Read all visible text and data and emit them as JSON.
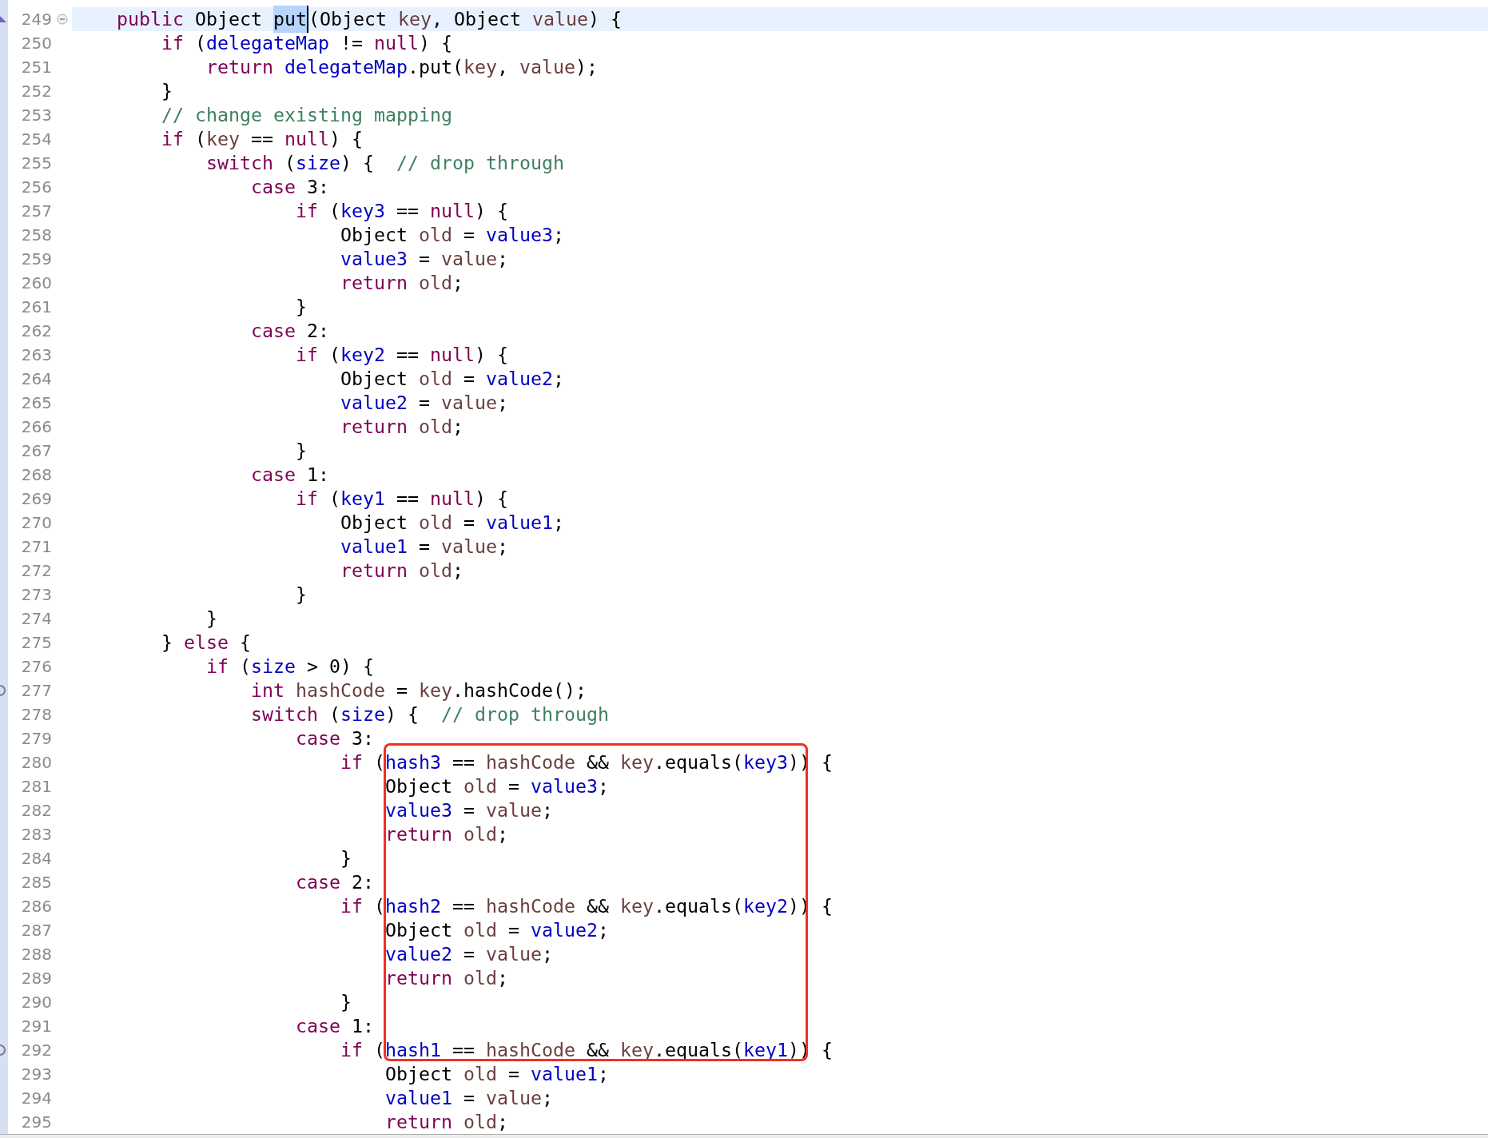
{
  "editor": {
    "lines": [
      {
        "number": "249",
        "current": true,
        "foldable": true,
        "marker": {
          "kind": "triangle"
        },
        "tokens": [
          {
            "text": "    public ",
            "kind": "keyword"
          },
          {
            "text": "Object ",
            "kind": "plain"
          },
          {
            "text": "put",
            "kind": "plain",
            "selected": true
          },
          {
            "text": "(Object ",
            "kind": "plain"
          },
          {
            "text": "key",
            "kind": "local"
          },
          {
            "text": ", Object ",
            "kind": "plain"
          },
          {
            "text": "value",
            "kind": "local"
          },
          {
            "text": ") {",
            "kind": "plain"
          }
        ]
      },
      {
        "number": "250",
        "current": false,
        "foldable": false,
        "tokens": [
          {
            "text": "        if",
            "kind": "keyword"
          },
          {
            "text": " (",
            "kind": "plain"
          },
          {
            "text": "delegateMap",
            "kind": "field"
          },
          {
            "text": " != ",
            "kind": "plain"
          },
          {
            "text": "null",
            "kind": "keyword"
          },
          {
            "text": ") {",
            "kind": "plain"
          }
        ]
      },
      {
        "number": "251",
        "current": false,
        "foldable": false,
        "tokens": [
          {
            "text": "            return ",
            "kind": "keyword"
          },
          {
            "text": "delegateMap",
            "kind": "field"
          },
          {
            "text": ".put(",
            "kind": "plain"
          },
          {
            "text": "key",
            "kind": "local"
          },
          {
            "text": ", ",
            "kind": "plain"
          },
          {
            "text": "value",
            "kind": "local"
          },
          {
            "text": ");",
            "kind": "plain"
          }
        ]
      },
      {
        "number": "252",
        "current": false,
        "foldable": false,
        "tokens": [
          {
            "text": "        }",
            "kind": "plain"
          }
        ]
      },
      {
        "number": "253",
        "current": false,
        "foldable": false,
        "tokens": [
          {
            "text": "        // change existing mapping",
            "kind": "comment"
          }
        ]
      },
      {
        "number": "254",
        "current": false,
        "foldable": false,
        "tokens": [
          {
            "text": "        if",
            "kind": "keyword"
          },
          {
            "text": " (",
            "kind": "plain"
          },
          {
            "text": "key",
            "kind": "local"
          },
          {
            "text": " == ",
            "kind": "plain"
          },
          {
            "text": "null",
            "kind": "keyword"
          },
          {
            "text": ") {",
            "kind": "plain"
          }
        ]
      },
      {
        "number": "255",
        "current": false,
        "foldable": false,
        "tokens": [
          {
            "text": "            switch",
            "kind": "keyword"
          },
          {
            "text": " (",
            "kind": "plain"
          },
          {
            "text": "size",
            "kind": "field"
          },
          {
            "text": ") {  ",
            "kind": "plain"
          },
          {
            "text": "// drop through",
            "kind": "comment"
          }
        ]
      },
      {
        "number": "256",
        "current": false,
        "foldable": false,
        "tokens": [
          {
            "text": "                case",
            "kind": "keyword"
          },
          {
            "text": " 3:",
            "kind": "plain"
          }
        ]
      },
      {
        "number": "257",
        "current": false,
        "foldable": false,
        "tokens": [
          {
            "text": "                    if",
            "kind": "keyword"
          },
          {
            "text": " (",
            "kind": "plain"
          },
          {
            "text": "key3",
            "kind": "field"
          },
          {
            "text": " == ",
            "kind": "plain"
          },
          {
            "text": "null",
            "kind": "keyword"
          },
          {
            "text": ") {",
            "kind": "plain"
          }
        ]
      },
      {
        "number": "258",
        "current": false,
        "foldable": false,
        "tokens": [
          {
            "text": "                        Object ",
            "kind": "plain"
          },
          {
            "text": "old",
            "kind": "local"
          },
          {
            "text": " = ",
            "kind": "plain"
          },
          {
            "text": "value3",
            "kind": "field"
          },
          {
            "text": ";",
            "kind": "plain"
          }
        ]
      },
      {
        "number": "259",
        "current": false,
        "foldable": false,
        "tokens": [
          {
            "text": "                        value3",
            "kind": "field"
          },
          {
            "text": " = ",
            "kind": "plain"
          },
          {
            "text": "value",
            "kind": "local"
          },
          {
            "text": ";",
            "kind": "plain"
          }
        ]
      },
      {
        "number": "260",
        "current": false,
        "foldable": false,
        "tokens": [
          {
            "text": "                        return ",
            "kind": "keyword"
          },
          {
            "text": "old",
            "kind": "local"
          },
          {
            "text": ";",
            "kind": "plain"
          }
        ]
      },
      {
        "number": "261",
        "current": false,
        "foldable": false,
        "tokens": [
          {
            "text": "                    }",
            "kind": "plain"
          }
        ]
      },
      {
        "number": "262",
        "current": false,
        "foldable": false,
        "tokens": [
          {
            "text": "                case",
            "kind": "keyword"
          },
          {
            "text": " 2:",
            "kind": "plain"
          }
        ]
      },
      {
        "number": "263",
        "current": false,
        "foldable": false,
        "tokens": [
          {
            "text": "                    if",
            "kind": "keyword"
          },
          {
            "text": " (",
            "kind": "plain"
          },
          {
            "text": "key2",
            "kind": "field"
          },
          {
            "text": " == ",
            "kind": "plain"
          },
          {
            "text": "null",
            "kind": "keyword"
          },
          {
            "text": ") {",
            "kind": "plain"
          }
        ]
      },
      {
        "number": "264",
        "current": false,
        "foldable": false,
        "tokens": [
          {
            "text": "                        Object ",
            "kind": "plain"
          },
          {
            "text": "old",
            "kind": "local"
          },
          {
            "text": " = ",
            "kind": "plain"
          },
          {
            "text": "value2",
            "kind": "field"
          },
          {
            "text": ";",
            "kind": "plain"
          }
        ]
      },
      {
        "number": "265",
        "current": false,
        "foldable": false,
        "tokens": [
          {
            "text": "                        value2",
            "kind": "field"
          },
          {
            "text": " = ",
            "kind": "plain"
          },
          {
            "text": "value",
            "kind": "local"
          },
          {
            "text": ";",
            "kind": "plain"
          }
        ]
      },
      {
        "number": "266",
        "current": false,
        "foldable": false,
        "tokens": [
          {
            "text": "                        return ",
            "kind": "keyword"
          },
          {
            "text": "old",
            "kind": "local"
          },
          {
            "text": ";",
            "kind": "plain"
          }
        ]
      },
      {
        "number": "267",
        "current": false,
        "foldable": false,
        "tokens": [
          {
            "text": "                    }",
            "kind": "plain"
          }
        ]
      },
      {
        "number": "268",
        "current": false,
        "foldable": false,
        "tokens": [
          {
            "text": "                case",
            "kind": "keyword"
          },
          {
            "text": " 1:",
            "kind": "plain"
          }
        ]
      },
      {
        "number": "269",
        "current": false,
        "foldable": false,
        "tokens": [
          {
            "text": "                    if",
            "kind": "keyword"
          },
          {
            "text": " (",
            "kind": "plain"
          },
          {
            "text": "key1",
            "kind": "field"
          },
          {
            "text": " == ",
            "kind": "plain"
          },
          {
            "text": "null",
            "kind": "keyword"
          },
          {
            "text": ") {",
            "kind": "plain"
          }
        ]
      },
      {
        "number": "270",
        "current": false,
        "foldable": false,
        "tokens": [
          {
            "text": "                        Object ",
            "kind": "plain"
          },
          {
            "text": "old",
            "kind": "local"
          },
          {
            "text": " = ",
            "kind": "plain"
          },
          {
            "text": "value1",
            "kind": "field"
          },
          {
            "text": ";",
            "kind": "plain"
          }
        ]
      },
      {
        "number": "271",
        "current": false,
        "foldable": false,
        "tokens": [
          {
            "text": "                        value1",
            "kind": "field"
          },
          {
            "text": " = ",
            "kind": "plain"
          },
          {
            "text": "value",
            "kind": "local"
          },
          {
            "text": ";",
            "kind": "plain"
          }
        ]
      },
      {
        "number": "272",
        "current": false,
        "foldable": false,
        "tokens": [
          {
            "text": "                        return ",
            "kind": "keyword"
          },
          {
            "text": "old",
            "kind": "local"
          },
          {
            "text": ";",
            "kind": "plain"
          }
        ]
      },
      {
        "number": "273",
        "current": false,
        "foldable": false,
        "tokens": [
          {
            "text": "                    }",
            "kind": "plain"
          }
        ]
      },
      {
        "number": "274",
        "current": false,
        "foldable": false,
        "tokens": [
          {
            "text": "            }",
            "kind": "plain"
          }
        ]
      },
      {
        "number": "275",
        "current": false,
        "foldable": false,
        "tokens": [
          {
            "text": "        } ",
            "kind": "plain"
          },
          {
            "text": "else",
            "kind": "keyword"
          },
          {
            "text": " {",
            "kind": "plain"
          }
        ]
      },
      {
        "number": "276",
        "current": false,
        "foldable": false,
        "tokens": [
          {
            "text": "            if",
            "kind": "keyword"
          },
          {
            "text": " (",
            "kind": "plain"
          },
          {
            "text": "size",
            "kind": "field"
          },
          {
            "text": " > 0) {",
            "kind": "plain"
          }
        ]
      },
      {
        "number": "277",
        "current": false,
        "foldable": false,
        "marker": {
          "kind": "arc"
        },
        "tokens": [
          {
            "text": "                int ",
            "kind": "keyword"
          },
          {
            "text": "hashCode",
            "kind": "local"
          },
          {
            "text": " = ",
            "kind": "plain"
          },
          {
            "text": "key",
            "kind": "local"
          },
          {
            "text": ".hashCode();",
            "kind": "plain"
          }
        ]
      },
      {
        "number": "278",
        "current": false,
        "foldable": false,
        "tokens": [
          {
            "text": "                switch",
            "kind": "keyword"
          },
          {
            "text": " (",
            "kind": "plain"
          },
          {
            "text": "size",
            "kind": "field"
          },
          {
            "text": ") {  ",
            "kind": "plain"
          },
          {
            "text": "// drop through",
            "kind": "comment"
          }
        ]
      },
      {
        "number": "279",
        "current": false,
        "foldable": false,
        "tokens": [
          {
            "text": "                    case",
            "kind": "keyword"
          },
          {
            "text": " 3:",
            "kind": "plain"
          }
        ]
      },
      {
        "number": "280",
        "current": false,
        "foldable": false,
        "tokens": [
          {
            "text": "                        if",
            "kind": "keyword"
          },
          {
            "text": " (",
            "kind": "plain"
          },
          {
            "text": "hash3",
            "kind": "field"
          },
          {
            "text": " == ",
            "kind": "plain"
          },
          {
            "text": "hashCode",
            "kind": "local"
          },
          {
            "text": " && ",
            "kind": "plain"
          },
          {
            "text": "key",
            "kind": "local"
          },
          {
            "text": ".equals(",
            "kind": "plain"
          },
          {
            "text": "key3",
            "kind": "field"
          },
          {
            "text": ")) {",
            "kind": "plain"
          }
        ]
      },
      {
        "number": "281",
        "current": false,
        "foldable": false,
        "tokens": [
          {
            "text": "                            Object ",
            "kind": "plain"
          },
          {
            "text": "old",
            "kind": "local"
          },
          {
            "text": " = ",
            "kind": "plain"
          },
          {
            "text": "value3",
            "kind": "field"
          },
          {
            "text": ";",
            "kind": "plain"
          }
        ]
      },
      {
        "number": "282",
        "current": false,
        "foldable": false,
        "tokens": [
          {
            "text": "                            value3",
            "kind": "field"
          },
          {
            "text": " = ",
            "kind": "plain"
          },
          {
            "text": "value",
            "kind": "local"
          },
          {
            "text": ";",
            "kind": "plain"
          }
        ]
      },
      {
        "number": "283",
        "current": false,
        "foldable": false,
        "tokens": [
          {
            "text": "                            return ",
            "kind": "keyword"
          },
          {
            "text": "old",
            "kind": "local"
          },
          {
            "text": ";",
            "kind": "plain"
          }
        ]
      },
      {
        "number": "284",
        "current": false,
        "foldable": false,
        "tokens": [
          {
            "text": "                        }",
            "kind": "plain"
          }
        ]
      },
      {
        "number": "285",
        "current": false,
        "foldable": false,
        "tokens": [
          {
            "text": "                    case",
            "kind": "keyword"
          },
          {
            "text": " 2:",
            "kind": "plain"
          }
        ]
      },
      {
        "number": "286",
        "current": false,
        "foldable": false,
        "tokens": [
          {
            "text": "                        if",
            "kind": "keyword"
          },
          {
            "text": " (",
            "kind": "plain"
          },
          {
            "text": "hash2",
            "kind": "field"
          },
          {
            "text": " == ",
            "kind": "plain"
          },
          {
            "text": "hashCode",
            "kind": "local"
          },
          {
            "text": " && ",
            "kind": "plain"
          },
          {
            "text": "key",
            "kind": "local"
          },
          {
            "text": ".equals(",
            "kind": "plain"
          },
          {
            "text": "key2",
            "kind": "field"
          },
          {
            "text": ")) {",
            "kind": "plain"
          }
        ]
      },
      {
        "number": "287",
        "current": false,
        "foldable": false,
        "tokens": [
          {
            "text": "                            Object ",
            "kind": "plain"
          },
          {
            "text": "old",
            "kind": "local"
          },
          {
            "text": " = ",
            "kind": "plain"
          },
          {
            "text": "value2",
            "kind": "field"
          },
          {
            "text": ";",
            "kind": "plain"
          }
        ]
      },
      {
        "number": "288",
        "current": false,
        "foldable": false,
        "tokens": [
          {
            "text": "                            value2",
            "kind": "field"
          },
          {
            "text": " = ",
            "kind": "plain"
          },
          {
            "text": "value",
            "kind": "local"
          },
          {
            "text": ";",
            "kind": "plain"
          }
        ]
      },
      {
        "number": "289",
        "current": false,
        "foldable": false,
        "tokens": [
          {
            "text": "                            return ",
            "kind": "keyword"
          },
          {
            "text": "old",
            "kind": "local"
          },
          {
            "text": ";",
            "kind": "plain"
          }
        ]
      },
      {
        "number": "290",
        "current": false,
        "foldable": false,
        "tokens": [
          {
            "text": "                        }",
            "kind": "plain"
          }
        ]
      },
      {
        "number": "291",
        "current": false,
        "foldable": false,
        "tokens": [
          {
            "text": "                    case",
            "kind": "keyword"
          },
          {
            "text": " 1:",
            "kind": "plain"
          }
        ]
      },
      {
        "number": "292",
        "current": false,
        "foldable": false,
        "marker": {
          "kind": "arc"
        },
        "tokens": [
          {
            "text": "                        if",
            "kind": "keyword"
          },
          {
            "text": " (",
            "kind": "plain"
          },
          {
            "text": "hash1",
            "kind": "field"
          },
          {
            "text": " == ",
            "kind": "plain"
          },
          {
            "text": "hashCode",
            "kind": "local"
          },
          {
            "text": " && ",
            "kind": "plain"
          },
          {
            "text": "key",
            "kind": "local"
          },
          {
            "text": ".equals(",
            "kind": "plain"
          },
          {
            "text": "key1",
            "kind": "field"
          },
          {
            "text": ")) {",
            "kind": "plain"
          }
        ]
      },
      {
        "number": "293",
        "current": false,
        "foldable": false,
        "tokens": [
          {
            "text": "                            Object ",
            "kind": "plain"
          },
          {
            "text": "old",
            "kind": "local"
          },
          {
            "text": " = ",
            "kind": "plain"
          },
          {
            "text": "value1",
            "kind": "field"
          },
          {
            "text": ";",
            "kind": "plain"
          }
        ]
      },
      {
        "number": "294",
        "current": false,
        "foldable": false,
        "tokens": [
          {
            "text": "                            value1",
            "kind": "field"
          },
          {
            "text": " = ",
            "kind": "plain"
          },
          {
            "text": "value",
            "kind": "local"
          },
          {
            "text": ";",
            "kind": "plain"
          }
        ]
      },
      {
        "number": "295",
        "current": false,
        "foldable": false,
        "tokens": [
          {
            "text": "                            return ",
            "kind": "keyword"
          },
          {
            "text": "old",
            "kind": "local"
          },
          {
            "text": ";",
            "kind": "plain"
          }
        ]
      }
    ],
    "annotation": {
      "kind": "frame",
      "color": "#ee3124"
    }
  }
}
